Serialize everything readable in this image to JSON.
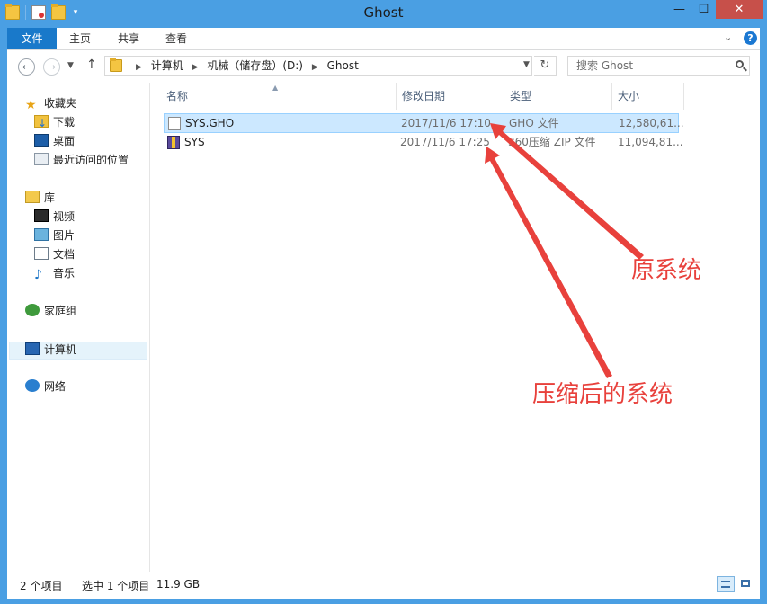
{
  "window": {
    "title": "Ghost"
  },
  "ribbon": {
    "tabs": [
      "文件",
      "主页",
      "共享",
      "查看"
    ]
  },
  "address": {
    "crumbs": [
      "计算机",
      "机械（储存盘）(D:)",
      "Ghost"
    ],
    "search_placeholder": "搜索 Ghost"
  },
  "navpane": {
    "favorites": "收藏夹",
    "downloads": "下载",
    "desktop": "桌面",
    "recent": "最近访问的位置",
    "libraries": "库",
    "videos": "视频",
    "pictures": "图片",
    "documents": "文档",
    "music": "音乐",
    "homegroup": "家庭组",
    "computer": "计算机",
    "network": "网络"
  },
  "columns": {
    "name": "名称",
    "date": "修改日期",
    "type": "类型",
    "size": "大小"
  },
  "files": [
    {
      "name": "SYS.GHO",
      "date": "2017/11/6 17:10",
      "type": "GHO 文件",
      "size": "12,580,61...",
      "selected": true
    },
    {
      "name": "SYS",
      "date": "2017/11/6 17:25",
      "type": "360压缩 ZIP 文件",
      "size": "11,094,81...",
      "selected": false
    }
  ],
  "status": {
    "count": "2 个项目",
    "selected": "选中 1 个项目",
    "size": "11.9 GB"
  },
  "annotations": {
    "original": "原系统",
    "compressed": "压缩后的系统",
    "color": "#e8413c"
  }
}
